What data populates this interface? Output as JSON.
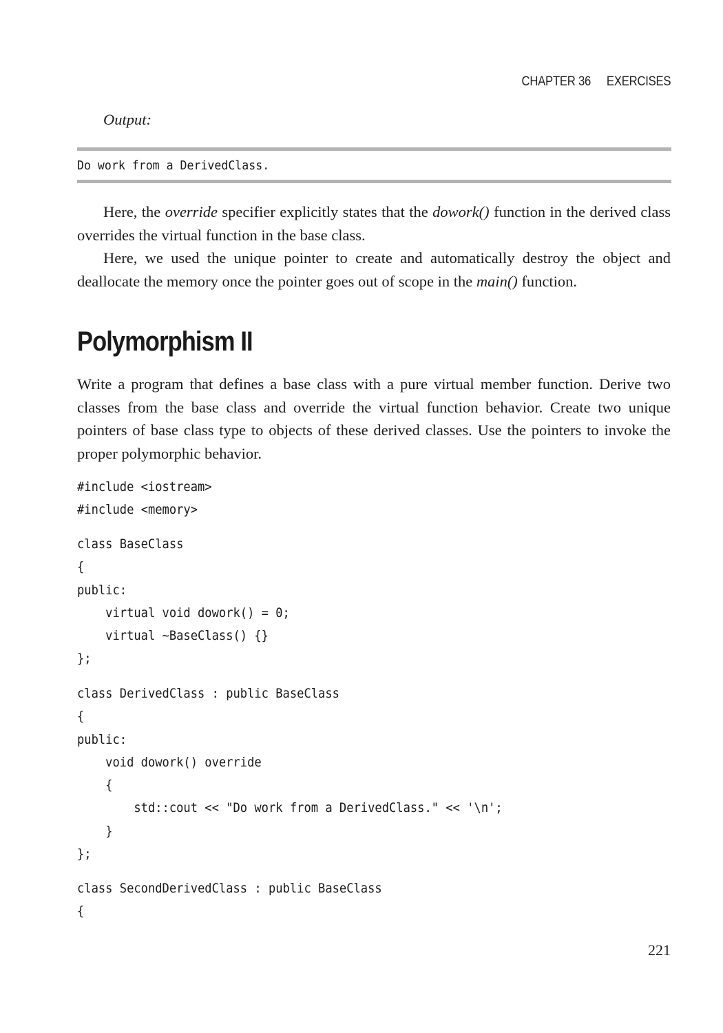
{
  "running_head": {
    "chapter": "CHAPTER 36",
    "title": "EXERCISES"
  },
  "output_section": {
    "label": "Output:",
    "text": "Do work from a DerivedClass."
  },
  "paragraphs": {
    "p1": {
      "part1": "Here, the ",
      "em1": "override",
      "part2": " specifier explicitly states that the ",
      "em2": "dowork()",
      "part3": " function in the derived class overrides the virtual function in the base class."
    },
    "p2": {
      "part1": "Here, we used the unique pointer to create and automatically destroy the object and deallocate the memory once the pointer goes out of scope in the ",
      "em1": "main()",
      "part2": " function."
    }
  },
  "section": {
    "heading": "Polymorphism II",
    "description": "Write a program that defines a base class with a pure virtual member function. Derive two classes from the base class and override the virtual function behavior. Create two unique pointers of base class type to objects of these derived classes. Use the pointers to invoke the proper polymorphic behavior."
  },
  "code_blocks": [
    [
      "#include <iostream>",
      "#include <memory>"
    ],
    [
      "class BaseClass",
      "{",
      "public:",
      "    virtual void dowork() = 0;",
      "    virtual ~BaseClass() {}",
      "};"
    ],
    [
      "class DerivedClass : public BaseClass",
      "{",
      "public:",
      "    void dowork() override",
      "    {",
      "        std::cout << \"Do work from a DerivedClass.\" << '\\n';",
      "    }",
      "};"
    ],
    [
      "class SecondDerivedClass : public BaseClass",
      "{"
    ]
  ],
  "page_number": "221"
}
